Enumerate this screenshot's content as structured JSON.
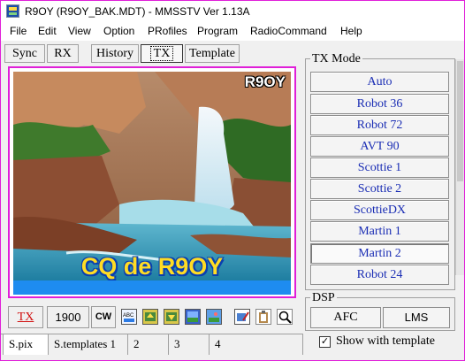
{
  "window": {
    "title": "R9OY (R9OY_BAK.MDT) - MMSSTV Ver 1.13A",
    "app_icon": "mmsstv-app-icon",
    "border_color": "#e01fd8"
  },
  "menubar": {
    "items": [
      "File",
      "Edit",
      "View",
      "Option",
      "PRofiles",
      "Program",
      "RadioCommand",
      "Help"
    ]
  },
  "main_tabs": {
    "items": [
      "Sync",
      "RX",
      "History",
      "TX",
      "Template"
    ],
    "active": "TX"
  },
  "tx_image": {
    "callsign_overlay": "R9OY",
    "cq_text": "CQ de R9OY",
    "band_color": "#1e8cf0",
    "text_color": "#ffdc24"
  },
  "toolbar": {
    "tx_label": "TX",
    "freq_label": "1900",
    "cw_label": "CW",
    "icons": [
      "font-abc-icon",
      "load-image-icon",
      "paste-image-icon",
      "clear-image-icon",
      "picture-icon",
      "picture-edit-icon",
      "clipboard-icon",
      "zoom-icon"
    ]
  },
  "status_tabs": {
    "items": [
      "S.pix",
      "S.templates 1",
      "2",
      "3",
      "4"
    ],
    "active": "S.pix"
  },
  "tx_mode": {
    "caption": "TX Mode",
    "modes": [
      "Auto",
      "Robot 36",
      "Robot 72",
      "AVT 90",
      "Scottie 1",
      "Scottie 2",
      "ScottieDX",
      "Martin 1",
      "Martin 2",
      "Robot 24"
    ],
    "selected": "Martin 2",
    "text_color": "#1a2db4"
  },
  "dsp": {
    "caption": "DSP",
    "buttons": [
      "AFC",
      "LMS"
    ]
  },
  "show_template": {
    "label": "Show with template",
    "checked": true,
    "check_mark": "✓"
  }
}
